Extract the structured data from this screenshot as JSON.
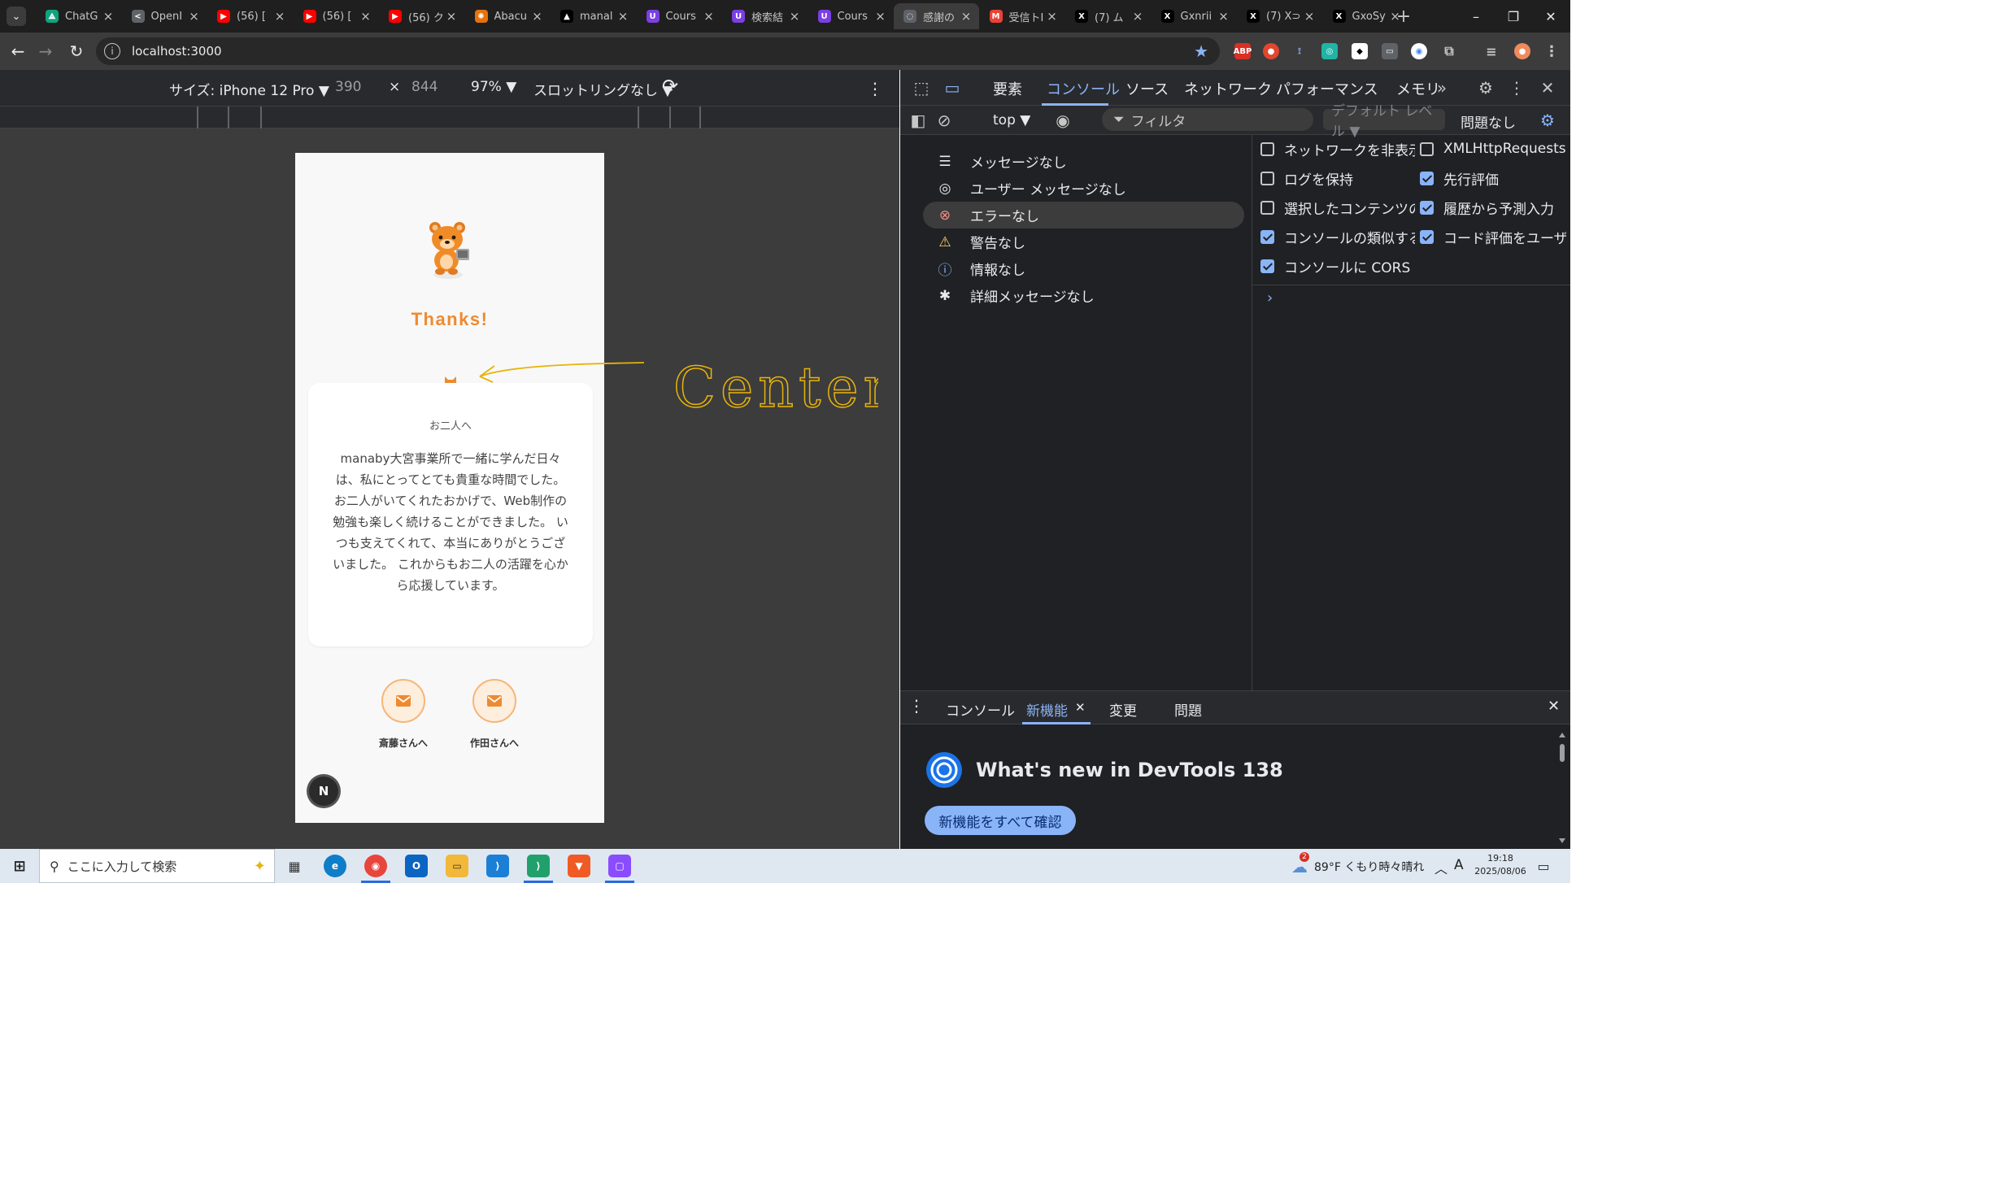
{
  "browser": {
    "tabs": [
      {
        "title": "ChatG",
        "favicon": "chatgpt-icon",
        "color": "#10a37f"
      },
      {
        "title": "OpenI",
        "favicon": "share-icon",
        "color": "#5f6368"
      },
      {
        "title": "(56) [",
        "favicon": "youtube-icon",
        "color": "#ff0000"
      },
      {
        "title": "(56) [",
        "favicon": "youtube-icon",
        "color": "#ff0000"
      },
      {
        "title": "(56) ク",
        "favicon": "youtube-icon",
        "color": "#ff0000"
      },
      {
        "title": "Abacu",
        "favicon": "abacus-icon",
        "color": "#e8710a"
      },
      {
        "title": "manal",
        "favicon": "triangle-icon",
        "color": "#000000"
      },
      {
        "title": "Cours",
        "favicon": "course-icon",
        "color": "#7b3fe4"
      },
      {
        "title": "検索結",
        "favicon": "course-icon",
        "color": "#7b3fe4"
      },
      {
        "title": "Cours",
        "favicon": "course-icon",
        "color": "#7b3fe4"
      },
      {
        "title": "感謝の",
        "favicon": "globe-icon",
        "color": "#5f6368",
        "active": true
      },
      {
        "title": "受信トI",
        "favicon": "gmail-icon",
        "color": "#ea4335"
      },
      {
        "title": "(7) ム",
        "favicon": "x-icon",
        "color": "#000000"
      },
      {
        "title": "Gxnrii",
        "favicon": "x-icon",
        "color": "#000000"
      },
      {
        "title": "(7) X⊃",
        "favicon": "x-icon",
        "color": "#000000"
      },
      {
        "title": "GxoSy",
        "favicon": "x-icon",
        "color": "#000000"
      }
    ],
    "url": "localhost:3000"
  },
  "device_toolbar": {
    "size_label": "サイズ: iPhone 12 Pro ▼",
    "width": "390",
    "times": "×",
    "height": "844",
    "zoom": "97% ▼",
    "throttle": "スロットリングなし ▼"
  },
  "page": {
    "thanks": "Thanks!",
    "card_to": "お二人へ",
    "card_message": "manaby大宮事業所で一緒に学んだ日々は、私にとってとても貴重な時間でした。 お二人がいてくれたおかげで、Web制作の勉強も楽しく続けることができました。 いつも支えてくれて、本当にありがとうございました。 これからもお二人の活躍を心から応援しています。",
    "buttons": [
      {
        "label": "斎藤さんへ",
        "icon": "mail-icon"
      },
      {
        "label": "作田さんへ",
        "icon": "mail-icon"
      }
    ],
    "next_badge": "N",
    "accent": "#ee8a30"
  },
  "annotation": {
    "text": "Center ?",
    "color": "#e8b30a"
  },
  "devtools": {
    "tabs": [
      "要素",
      "コンソール",
      "ソース",
      "ネットワーク",
      "パフォーマンス",
      "メモリ"
    ],
    "active_tab": "コンソール",
    "context": "top ▼",
    "filter_placeholder": "フィルタ",
    "level": "デフォルト レベル ▼",
    "issues": "問題なし",
    "sidebar": [
      {
        "label": "メッセージなし",
        "icon": "list-icon"
      },
      {
        "label": "ユーザー メッセージなし",
        "icon": "user-icon"
      },
      {
        "label": "エラーなし",
        "icon": "error-icon"
      },
      {
        "label": "警告なし",
        "icon": "warning-icon"
      },
      {
        "label": "情報なし",
        "icon": "info-icon"
      },
      {
        "label": "詳細メッセージなし",
        "icon": "bug-icon"
      }
    ],
    "settings": [
      {
        "label": "ネットワークを非表示",
        "checked": false
      },
      {
        "label": "XMLHttpRequests...",
        "checked": false
      },
      {
        "label": "ログを保持",
        "checked": false
      },
      {
        "label": "先行評価",
        "checked": true
      },
      {
        "label": "選択したコンテンツの...",
        "checked": false
      },
      {
        "label": "履歴から予測入力",
        "checked": true
      },
      {
        "label": "コンソールの類似する...",
        "checked": true
      },
      {
        "label": "コード評価をユーザー ...",
        "checked": true
      },
      {
        "label": "コンソールに CORS ...",
        "checked": true
      }
    ],
    "prompt": "›",
    "drawer_tabs": [
      "コンソール",
      "新機能",
      "変更",
      "問題"
    ],
    "drawer_active": "新機能",
    "whats_new_title": "What's new in DevTools 138",
    "whats_new_button": "新機能をすべて確認"
  },
  "taskbar": {
    "search_placeholder": "ここに入力して検索",
    "weather": "89°F くもり時々晴れ",
    "ime": "A",
    "time": "19:18",
    "date": "2025/08/06",
    "weather_badge": "2"
  }
}
